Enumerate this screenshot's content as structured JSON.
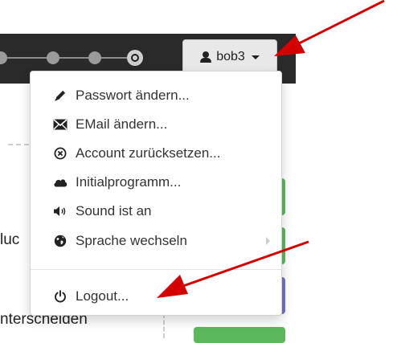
{
  "header": {
    "user_label": "bob3"
  },
  "menu": {
    "items": [
      {
        "label": "Passwort ändern...",
        "icon": "pencil-icon"
      },
      {
        "label": "EMail ändern...",
        "icon": "envelope-icon"
      },
      {
        "label": "Account zurücksetzen...",
        "icon": "reset-circle-x-icon"
      },
      {
        "label": "Initialprogramm...",
        "icon": "cloud-icon"
      },
      {
        "label": "Sound ist an",
        "icon": "speaker-icon"
      },
      {
        "label": "Sprache wechseln",
        "icon": "globe-icon"
      },
      {
        "label": "Logout...",
        "icon": "power-icon"
      }
    ]
  },
  "background": {
    "text1": "luc",
    "text2": "nterscheiden"
  },
  "colors": {
    "topbar": "#2a2a2a",
    "annotation_arrow": "#d40000",
    "green": "#5cb85c",
    "purple": "#6f74c6"
  }
}
